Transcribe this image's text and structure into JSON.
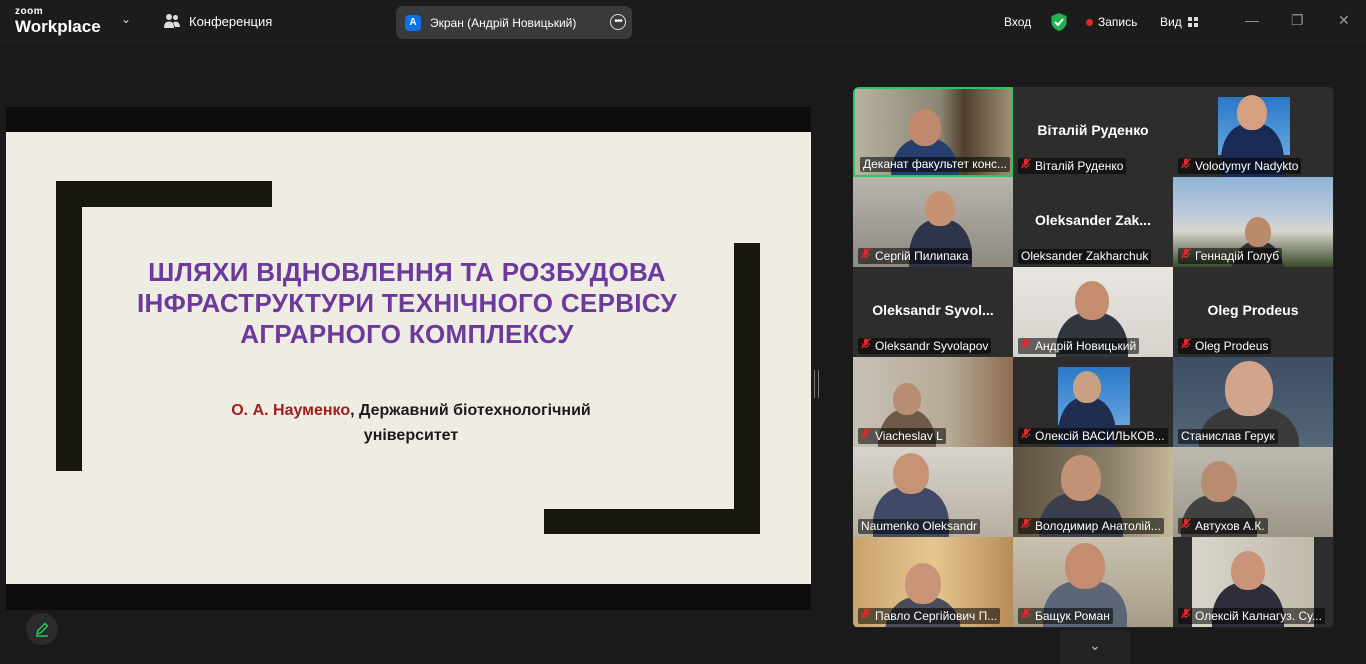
{
  "app": {
    "logo_line1": "zoom",
    "logo_line2": "Workplace"
  },
  "header": {
    "conference_label": "Конференция",
    "screen_share_label": "Экран (Андрій Новицький)",
    "screen_badge": "A",
    "join_label": "Вход",
    "record_label": "Запись",
    "view_label": "Вид"
  },
  "slide": {
    "title": "ШЛЯХИ ВІДНОВЛЕННЯ ТА РОЗБУДОВА ІНФРАСТРУКТУРИ ТЕХНІЧНОГО СЕРВІСУ АГРАРНОГО КОМПЛЕКСУ",
    "author_name": "О. А. Науменко",
    "author_affiliation": ", Державний біотехнологічний університет"
  },
  "participants": [
    {
      "label": "Деканат факультет конс...",
      "muted": false,
      "video": true,
      "active": true
    },
    {
      "label": "Віталій Руденко",
      "center_name": "Віталій Руденко",
      "muted": true,
      "video": false
    },
    {
      "label": "Volodymyr Nadykto",
      "muted": true,
      "video": true
    },
    {
      "label": "Сергій Пилипака",
      "muted": true,
      "video": true
    },
    {
      "label": "Oleksander Zakharchuk",
      "center_name": "Oleksander  Zak...",
      "muted": false,
      "video": false
    },
    {
      "label": "Геннадій Голуб",
      "muted": true,
      "video": true
    },
    {
      "label": "Oleksandr Syvolapov",
      "center_name": "Oleksandr  Syvol...",
      "muted": true,
      "video": false
    },
    {
      "label": "Андрій Новицький",
      "muted": true,
      "video": true
    },
    {
      "label": "Oleg Prodeus",
      "center_name": "Oleg Prodeus",
      "muted": true,
      "video": false
    },
    {
      "label": "Viacheslav L",
      "muted": true,
      "video": true
    },
    {
      "label": "Олексій ВАСИЛЬКОВ...",
      "muted": true,
      "video": true
    },
    {
      "label": "Станислав Герук",
      "muted": false,
      "video": true
    },
    {
      "label": "Naumenko Oleksandr",
      "muted": false,
      "video": true
    },
    {
      "label": "Володимир Анатолій...",
      "muted": true,
      "video": true
    },
    {
      "label": "Автухов А.К.",
      "muted": true,
      "video": true
    },
    {
      "label": "Павло Сергійович П...",
      "muted": true,
      "video": true
    },
    {
      "label": "Бащук Роман",
      "muted": true,
      "video": true
    },
    {
      "label": "Олексій Калнагуз. Су...",
      "muted": true,
      "video": true
    }
  ],
  "colors": {
    "active_speaker": "#2ec45f",
    "muted_mic": "#e02828",
    "slide_title": "#6c3a9c",
    "author_name": "#a11d1d"
  }
}
